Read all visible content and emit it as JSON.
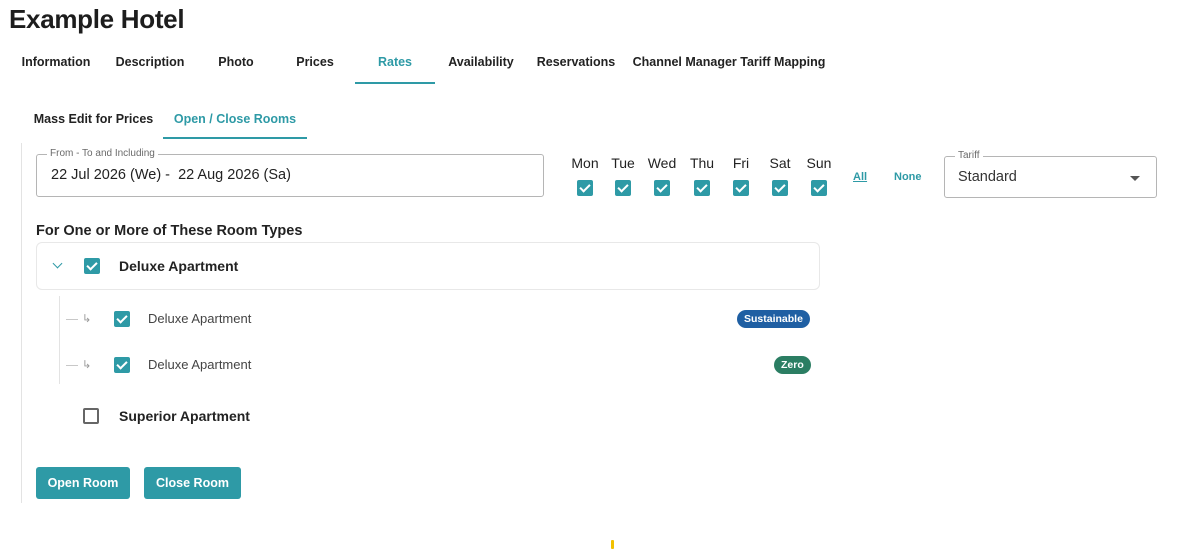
{
  "page": {
    "title": "Example Hotel"
  },
  "tabs": [
    {
      "label": "Information"
    },
    {
      "label": "Description"
    },
    {
      "label": "Photo"
    },
    {
      "label": "Prices"
    },
    {
      "label": "Rates",
      "active": true
    },
    {
      "label": "Availability"
    },
    {
      "label": "Reservations"
    },
    {
      "label": "Channel Manager Tariff Mapping"
    }
  ],
  "subtabs": [
    {
      "label": "Mass Edit for Prices"
    },
    {
      "label": "Open / Close Rooms",
      "active": true
    }
  ],
  "date_range": {
    "legend": "From - To and Including",
    "value": "22 Jul 2026 (We) -  22 Aug 2026 (Sa)"
  },
  "weekdays": [
    {
      "label": "Mon",
      "checked": true
    },
    {
      "label": "Tue",
      "checked": true
    },
    {
      "label": "Wed",
      "checked": true
    },
    {
      "label": "Thu",
      "checked": true
    },
    {
      "label": "Fri",
      "checked": true
    },
    {
      "label": "Sat",
      "checked": true
    },
    {
      "label": "Sun",
      "checked": true
    }
  ],
  "select_links": {
    "all": "All",
    "none": "None"
  },
  "tariff": {
    "legend": "Tariff",
    "value": "Standard"
  },
  "room_types": {
    "heading": "For One or More of These Room Types",
    "groups": [
      {
        "label": "Deluxe Apartment",
        "expanded": true,
        "checked": true,
        "children": [
          {
            "label": "Deluxe Apartment",
            "checked": true,
            "badge": "Sustainable"
          },
          {
            "label": "Deluxe Apartment",
            "checked": true,
            "badge": "Zero"
          }
        ]
      },
      {
        "label": "Superior Apartment",
        "checked": false
      }
    ]
  },
  "actions": {
    "open": "Open Room",
    "close": "Close Room"
  },
  "colors": {
    "accent": "#2e9aa6",
    "badge_sustainable": "#1f5fa3",
    "badge_zero": "#2b7e63"
  }
}
